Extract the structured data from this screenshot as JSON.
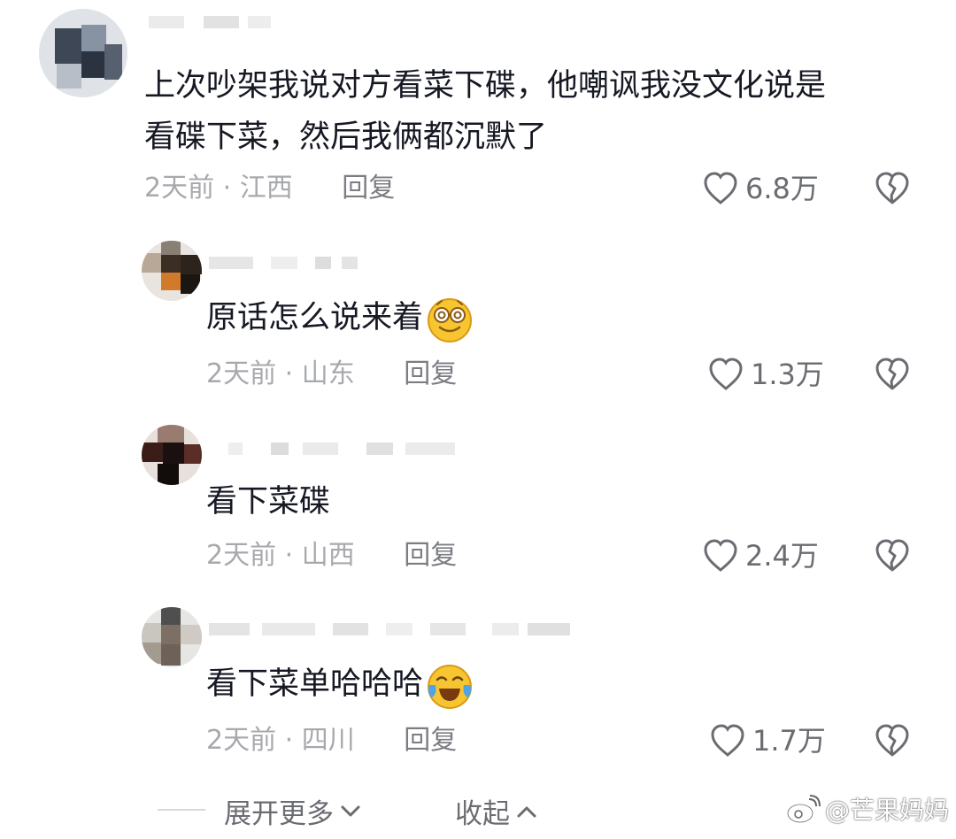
{
  "comments": [
    {
      "text_lines": [
        "上次吵架我说对方看菜下碟，他嘲讽我没文化说是",
        "看碟下菜，然后我俩都沉默了"
      ],
      "time": "2天前",
      "location": "江西",
      "reply_label": "回复",
      "likes": "6.8万",
      "emoji": null
    },
    {
      "text_lines": [
        "原话怎么说来着"
      ],
      "time": "2天前",
      "location": "山东",
      "reply_label": "回复",
      "likes": "1.3万",
      "emoji": "dizzy-eyes-emoji"
    },
    {
      "text_lines": [
        "看下菜碟"
      ],
      "time": "2天前",
      "location": "山西",
      "reply_label": "回复",
      "likes": "2.4万",
      "emoji": null
    },
    {
      "text_lines": [
        "看下菜单哈哈哈"
      ],
      "time": "2天前",
      "location": "四川",
      "reply_label": "回复",
      "likes": "1.7万",
      "emoji": "laugh-cry-emoji"
    }
  ],
  "separator": "·",
  "footer": {
    "expand_label": "展开更多",
    "collapse_label": "收起",
    "watermark": "@芒果妈妈"
  },
  "icons": {
    "like": "heart-outline-icon",
    "dislike": "broken-heart-icon",
    "expand": "chevron-down-icon",
    "collapse": "chevron-up-icon",
    "watermark": "weibo-icon"
  }
}
